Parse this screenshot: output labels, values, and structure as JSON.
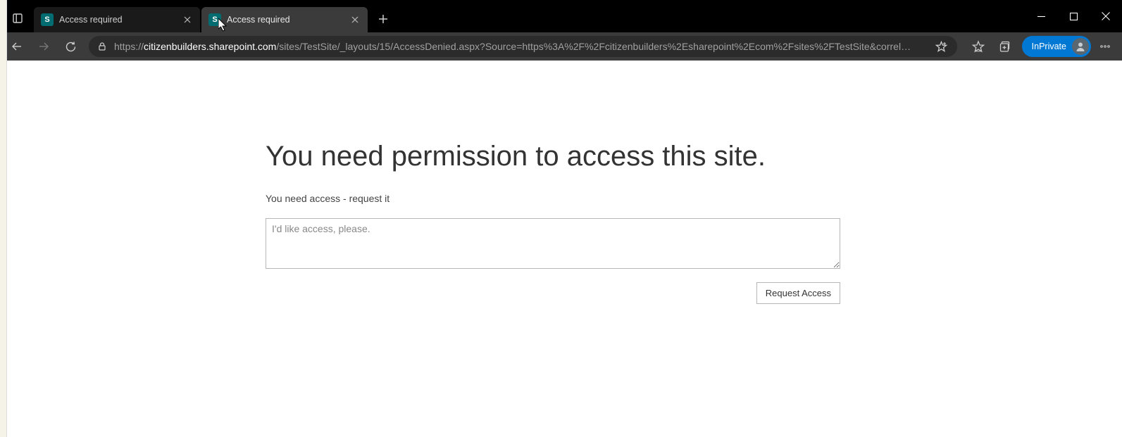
{
  "window": {
    "tabs": [
      {
        "favicon_letter": "S",
        "title": "Access required",
        "active": false
      },
      {
        "favicon_letter": "S",
        "title": "Access required",
        "active": true
      }
    ],
    "inprivate_label": "InPrivate"
  },
  "addressbar": {
    "url_prefix": "https://",
    "url_host": "citizenbuilders.sharepoint.com",
    "url_path": "/sites/TestSite/_layouts/15/AccessDenied.aspx?Source=https%3A%2F%2Fcitizenbuilders%2Esharepoint%2Ecom%2Fsites%2FTestSite&correl…"
  },
  "page": {
    "heading": "You need permission to access this site.",
    "subtext": "You need access - request it",
    "textarea_placeholder": "I'd like access, please.",
    "request_button": "Request Access"
  }
}
